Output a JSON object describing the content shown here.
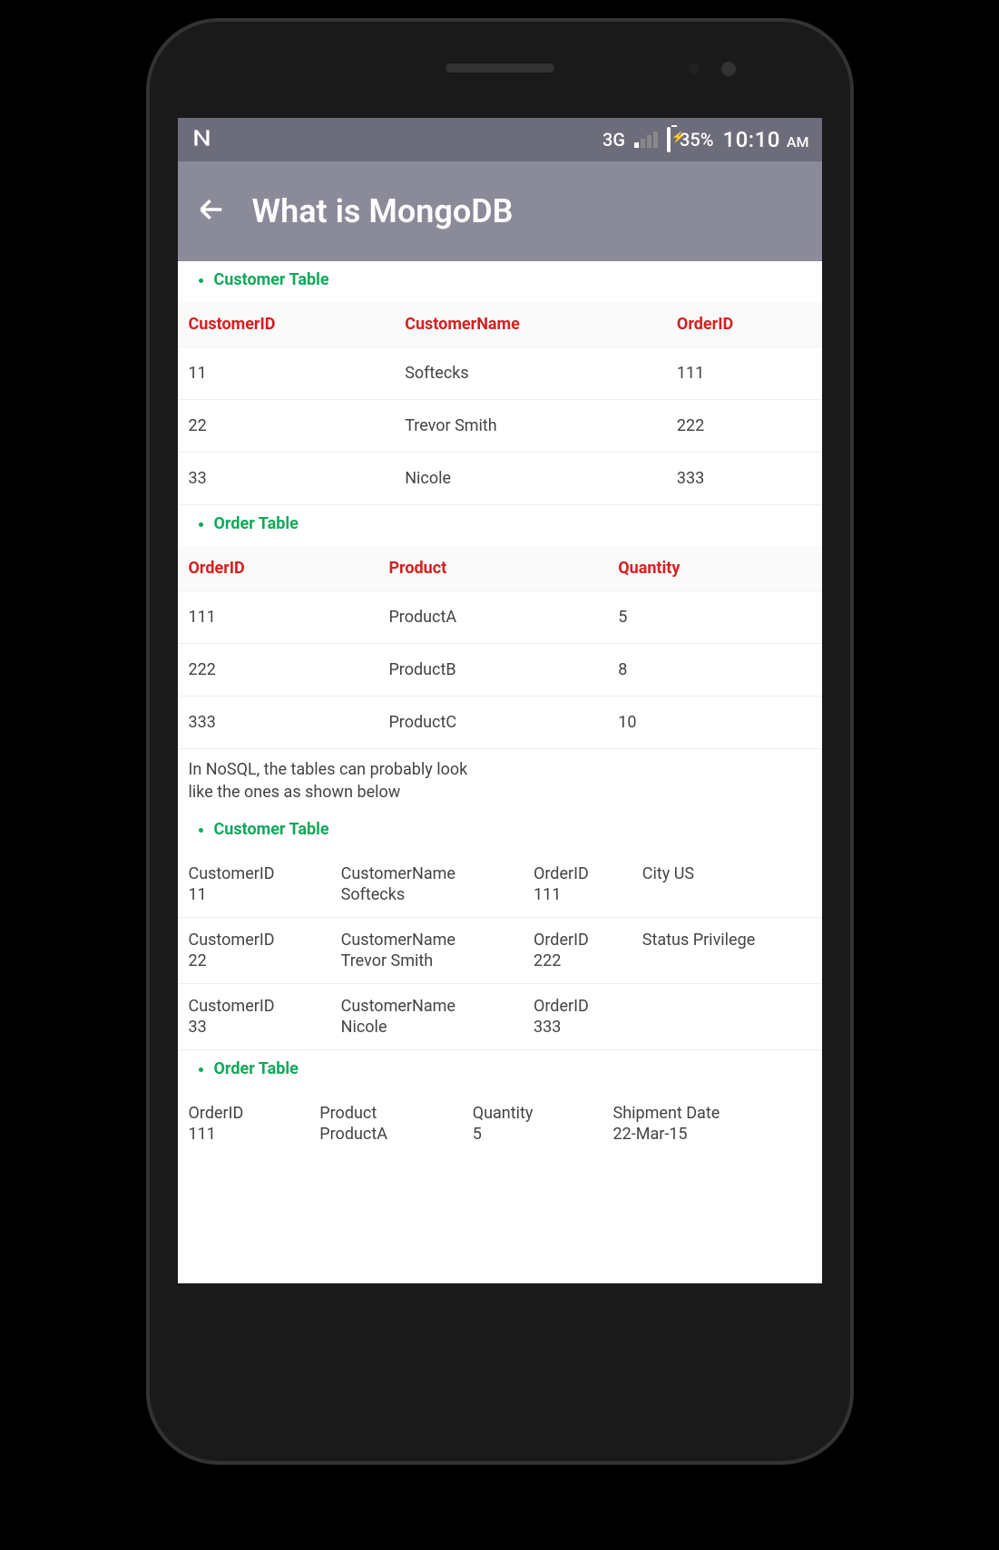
{
  "statusbar": {
    "network": "3G",
    "battery": "35%",
    "time": "10:10",
    "ampm": "AM"
  },
  "appbar": {
    "title": "What is MongoDB"
  },
  "section1": {
    "title": "Customer Table",
    "headers": [
      "CustomerID",
      "CustomerName",
      "OrderID"
    ],
    "rows": [
      [
        "11",
        "Softecks",
        "111"
      ],
      [
        "22",
        "Trevor Smith",
        "222"
      ],
      [
        "33",
        "Nicole",
        "333"
      ]
    ]
  },
  "section2": {
    "title": "Order Table",
    "headers": [
      "OrderID",
      "Product",
      "Quantity"
    ],
    "rows": [
      [
        "111",
        "ProductA",
        "5"
      ],
      [
        "222",
        "ProductB",
        "8"
      ],
      [
        "333",
        "ProductC",
        "10"
      ]
    ]
  },
  "note": "In NoSQL, the tables can probably look like the ones as shown below",
  "section3": {
    "title": "Customer Table",
    "labels": [
      "CustomerID",
      "CustomerName",
      "OrderID"
    ],
    "rows": [
      {
        "values": [
          "11",
          "Softecks",
          "111"
        ],
        "extra": "City US"
      },
      {
        "values": [
          "22",
          "Trevor Smith",
          "222"
        ],
        "extra": "Status Privilege"
      },
      {
        "values": [
          "33",
          "Nicole",
          "333"
        ],
        "extra": ""
      }
    ]
  },
  "section4": {
    "title": "Order Table",
    "labels": [
      "OrderID",
      "Product",
      "Quantity",
      "Shipment Date"
    ],
    "rows": [
      {
        "values": [
          "111",
          "ProductA",
          "5",
          "22-Mar-15"
        ]
      }
    ]
  }
}
